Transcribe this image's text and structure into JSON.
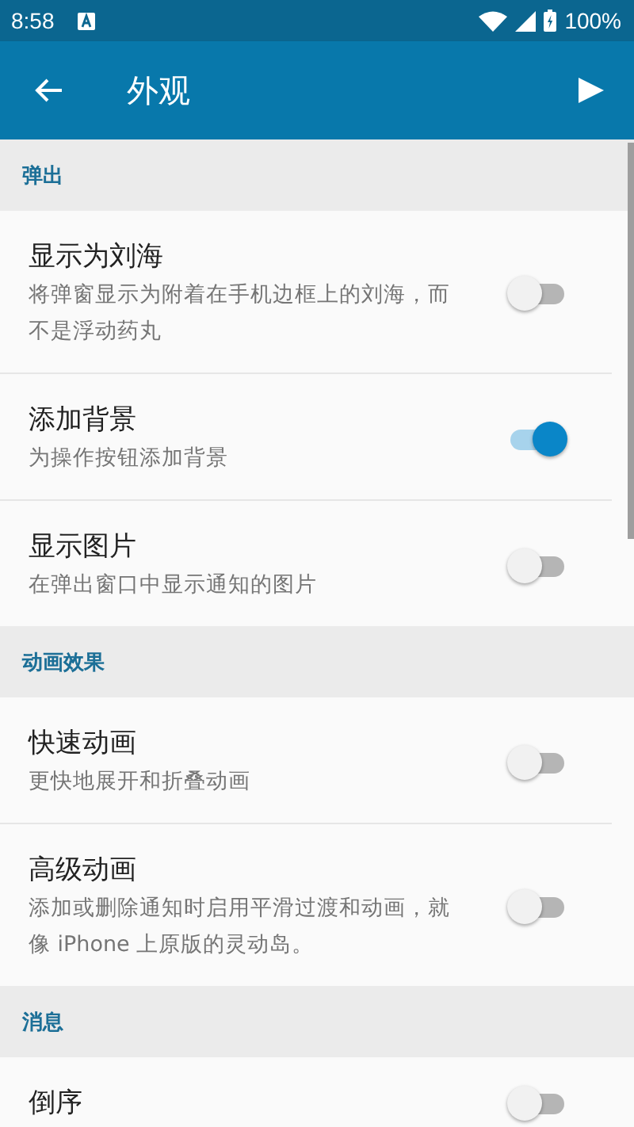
{
  "status_bar": {
    "time": "8:58",
    "battery": "100%"
  },
  "app_bar": {
    "title": "外观"
  },
  "sections": [
    {
      "title": "弹出",
      "items": [
        {
          "title": "显示为刘海",
          "subtitle": "将弹窗显示为附着在手机边框上的刘海，而不是浮动药丸",
          "on": false
        },
        {
          "title": "添加背景",
          "subtitle": "为操作按钮添加背景",
          "on": true
        },
        {
          "title": "显示图片",
          "subtitle": "在弹出窗口中显示通知的图片",
          "on": false
        }
      ]
    },
    {
      "title": "动画效果",
      "items": [
        {
          "title": "快速动画",
          "subtitle": "更快地展开和折叠动画",
          "on": false
        },
        {
          "title": "高级动画",
          "subtitle": "添加或删除通知时启用平滑过渡和动画，就像 iPhone 上原版的灵动岛。",
          "on": false
        }
      ]
    },
    {
      "title": "消息",
      "items": [
        {
          "title": "倒序",
          "on": false
        }
      ]
    }
  ]
}
